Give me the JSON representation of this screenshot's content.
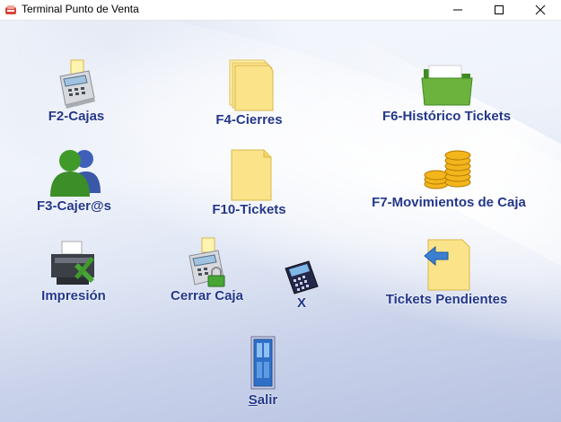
{
  "window": {
    "title": "Terminal Punto de Venta"
  },
  "menu": {
    "cajas": "F2-Cajas",
    "cierres": "F4-Cierres",
    "historico": "F6-Histórico Tickets",
    "cajeros": "F3-Cajer@s",
    "tickets": "F10-Tickets",
    "movimientos": "F7-Movimientos de Caja",
    "impresion": "Impresión",
    "cerrar_caja": "Cerrar Caja",
    "x": "X",
    "pendientes": "Tickets Pendientes",
    "salir": "Salir"
  },
  "colors": {
    "label": "#23378a",
    "folder_yellow": "#fbe38a",
    "folder_green": "#4f9a2c"
  },
  "icons": {
    "cajas": "cash-register-icon",
    "cierres": "stacked-papers-icon",
    "historico": "green-folder-icon",
    "cajeros": "users-icon",
    "tickets": "paper-icon",
    "movimientos": "coins-icon",
    "impresion": "printer-tools-icon",
    "cerrar_caja": "cash-register-lock-icon",
    "x": "calculator-icon",
    "pendientes": "paper-arrow-icon",
    "salir": "door-icon"
  }
}
